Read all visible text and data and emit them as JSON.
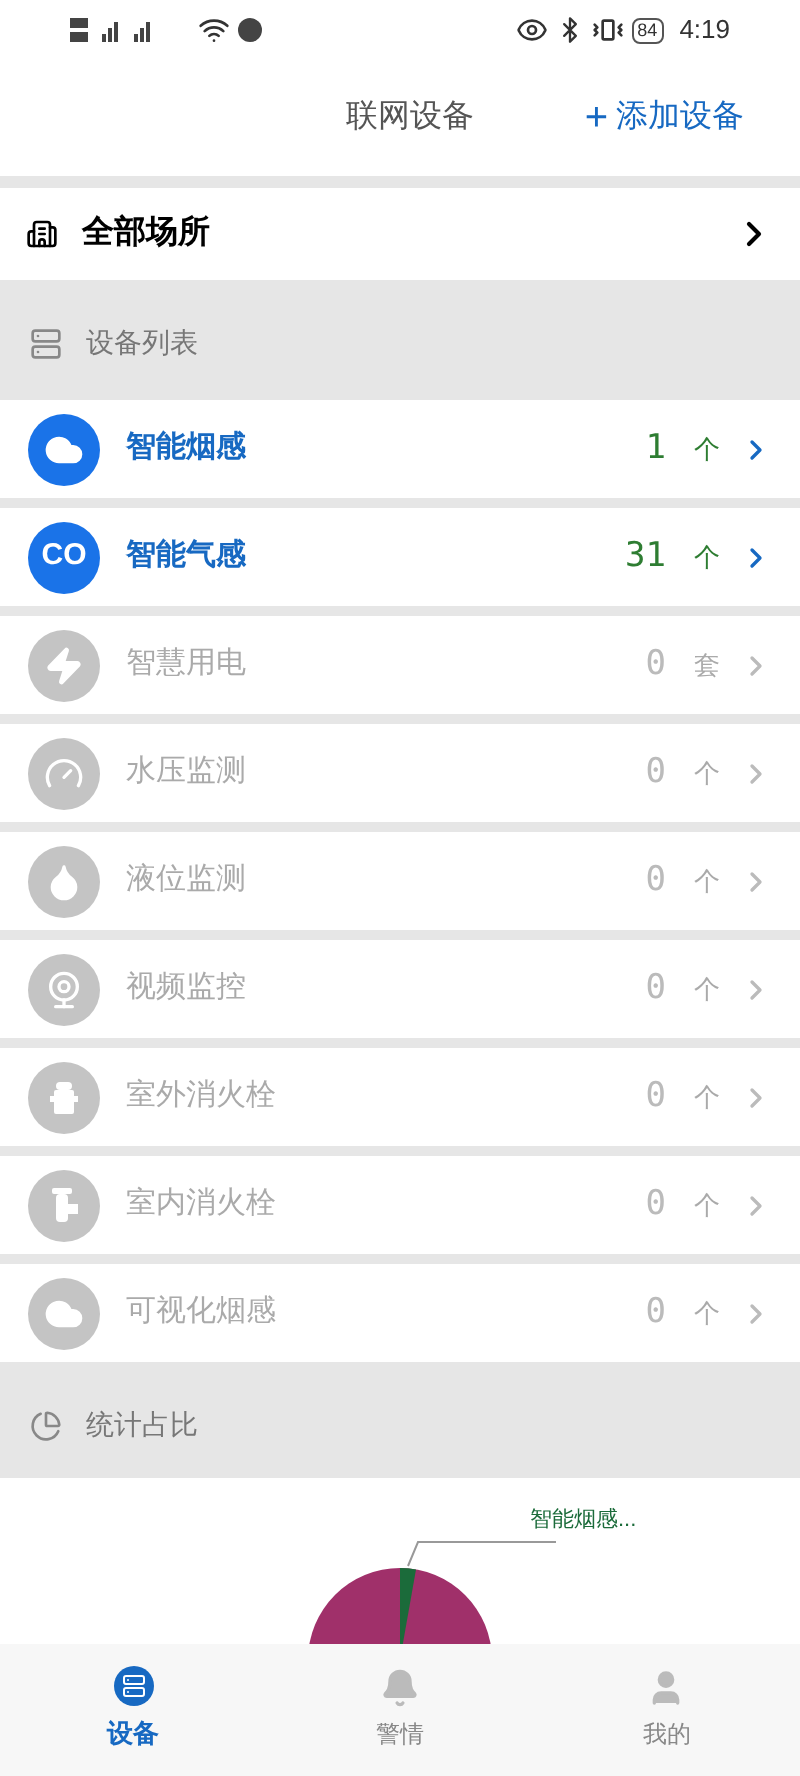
{
  "status_bar": {
    "time": "4:19",
    "battery": "84"
  },
  "header": {
    "title": "联网设备",
    "add_button": "添加设备",
    "add_icon": "+"
  },
  "place_selector": {
    "label": "全部场所"
  },
  "device_section": {
    "title": "设备列表"
  },
  "devices": [
    {
      "kind": "smoke",
      "name": "智能烟感",
      "count": "1",
      "unit": "个",
      "active": true
    },
    {
      "kind": "gas",
      "name": "智能气感",
      "count": "31",
      "unit": "个",
      "active": true,
      "icon_text": "CO"
    },
    {
      "kind": "power",
      "name": "智慧用电",
      "count": "0",
      "unit": "套",
      "active": false
    },
    {
      "kind": "pressure",
      "name": "水压监测",
      "count": "0",
      "unit": "个",
      "active": false
    },
    {
      "kind": "level",
      "name": "液位监测",
      "count": "0",
      "unit": "个",
      "active": false
    },
    {
      "kind": "camera",
      "name": "视频监控",
      "count": "0",
      "unit": "个",
      "active": false
    },
    {
      "kind": "hydrant",
      "name": "室外消火栓",
      "count": "0",
      "unit": "个",
      "active": false
    },
    {
      "kind": "valve",
      "name": "室内消火栓",
      "count": "0",
      "unit": "个",
      "active": false
    },
    {
      "kind": "visual",
      "name": "可视化烟感",
      "count": "0",
      "unit": "个",
      "active": false
    }
  ],
  "stats_section": {
    "title": "统计占比",
    "slice_label": "智能烟感..."
  },
  "bottom_nav": [
    {
      "kind": "device",
      "label": "设备",
      "selected": true
    },
    {
      "kind": "alarm",
      "label": "警情",
      "selected": false
    },
    {
      "kind": "me",
      "label": "我的",
      "selected": false
    }
  ]
}
